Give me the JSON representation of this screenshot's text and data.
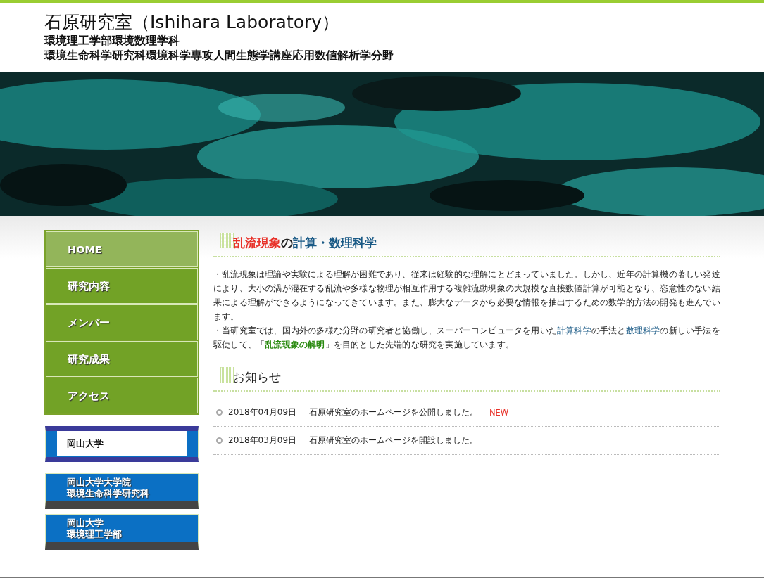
{
  "header": {
    "title": "石原研究室（Ishihara Laboratory）",
    "subtitles": [
      "環境理工学部環境数理学科",
      "環境生命科学研究科環境科学専攻人間生態学講座応用数値解析学分野"
    ]
  },
  "nav": [
    {
      "label": "HOME",
      "selected": true
    },
    {
      "label": "研究内容",
      "selected": false
    },
    {
      "label": "メンバー",
      "selected": false
    },
    {
      "label": "研究成果",
      "selected": false
    },
    {
      "label": "アクセス",
      "selected": false
    }
  ],
  "university_links": [
    {
      "kind": "framed",
      "lines": [
        "岡山大学"
      ]
    },
    {
      "kind": "plain",
      "lines": [
        "岡山大学大学院",
        "環境生命科学研究科"
      ]
    },
    {
      "kind": "plain",
      "lines": [
        "岡山大学",
        "環境理工学部"
      ]
    }
  ],
  "intro": {
    "heading": [
      {
        "kind": "accent",
        "text": "乱流現象"
      },
      {
        "kind": "plain",
        "text": "の"
      },
      {
        "kind": "link",
        "text": "計算・数理科学"
      }
    ],
    "paragraphs": [
      [
        {
          "kind": "plain",
          "text": "・乱流現象は理論や実験による理解が困難であり、従来は経験的な理解にとどまっていました。しかし、近年の計算機の著しい発達により、大小の渦が混在する乱流や多様な物理が相互作用する複雑流動現象の大規模な直接数値計算が可能となり、恣意性のない結果による理解ができるようになってきています。また、膨大なデータから必要な情報を抽出するための数学的方法の開発も進んでいます。"
        }
      ],
      [
        {
          "kind": "plain",
          "text": "・当研究室では、国内外の多様な分野の研究者と協働し、スーパーコンピュータを用いた"
        },
        {
          "kind": "link",
          "text": "計算科学"
        },
        {
          "kind": "plain",
          "text": "の手法と"
        },
        {
          "kind": "link",
          "text": "数理科学"
        },
        {
          "kind": "plain",
          "text": "の新しい手法を駆使して、「"
        },
        {
          "kind": "highlight",
          "text": "乱流現象の解明"
        },
        {
          "kind": "plain",
          "text": "」を目的とした先端的な研究を実施しています。"
        }
      ]
    ]
  },
  "news": {
    "heading": "お知らせ",
    "items": [
      {
        "date": "2018年04月09日",
        "text": "石原研究室のホームページを公開しました。",
        "badge": "NEW"
      },
      {
        "date": "2018年03月09日",
        "text": "石原研究室のホームページを開設しました。"
      }
    ]
  }
}
